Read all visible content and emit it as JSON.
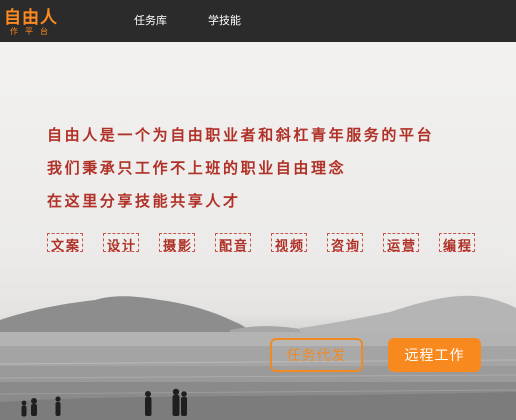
{
  "header": {
    "logo_text": "自由人",
    "logo_sub": "作平台",
    "nav": [
      {
        "label": "任务库"
      },
      {
        "label": "学技能"
      }
    ]
  },
  "hero": {
    "taglines": [
      "自由人是一个为自由职业者和斜杠青年服务的平台",
      "我们秉承只工作不上班的职业自由理念",
      "在这里分享技能共享人才"
    ],
    "skills": [
      "文案",
      "设计",
      "摄影",
      "配音",
      "视频",
      "咨询",
      "运营",
      "编程"
    ],
    "buttons": {
      "post_task": "任务代发",
      "remote_work": "远程工作"
    }
  },
  "colors": {
    "brand_orange": "#f7891f",
    "tagline_red": "#b03127",
    "header_bg": "#2b2b2b"
  }
}
